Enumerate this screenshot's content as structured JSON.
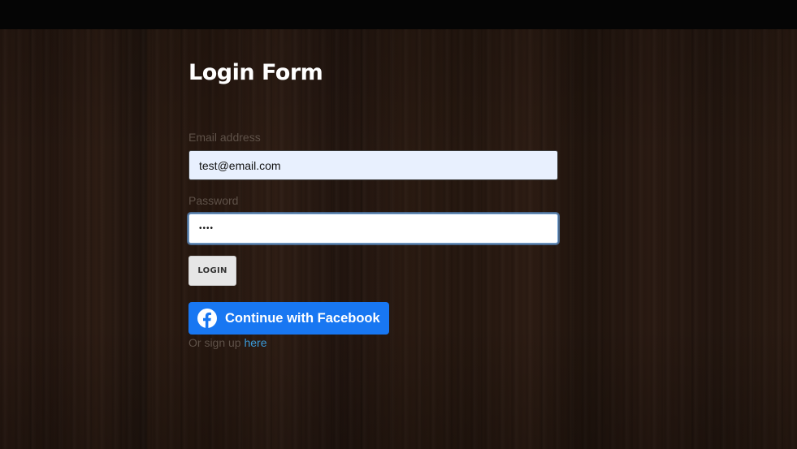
{
  "form": {
    "title": "Login Form",
    "email_label": "Email address",
    "email_value": "test@email.com",
    "password_label": "Password",
    "password_value": "••••",
    "login_button": "LOGIN",
    "facebook_button": "Continue with Facebook",
    "signup_prefix": "Or sign up ",
    "signup_link": "here"
  },
  "icons": {
    "facebook": "facebook-icon"
  },
  "colors": {
    "topbar": "#050505",
    "background": "#2a1a12",
    "facebook_blue": "#1877f2",
    "link": "#3a9ad9",
    "email_autofill": "#e8f0fe"
  }
}
